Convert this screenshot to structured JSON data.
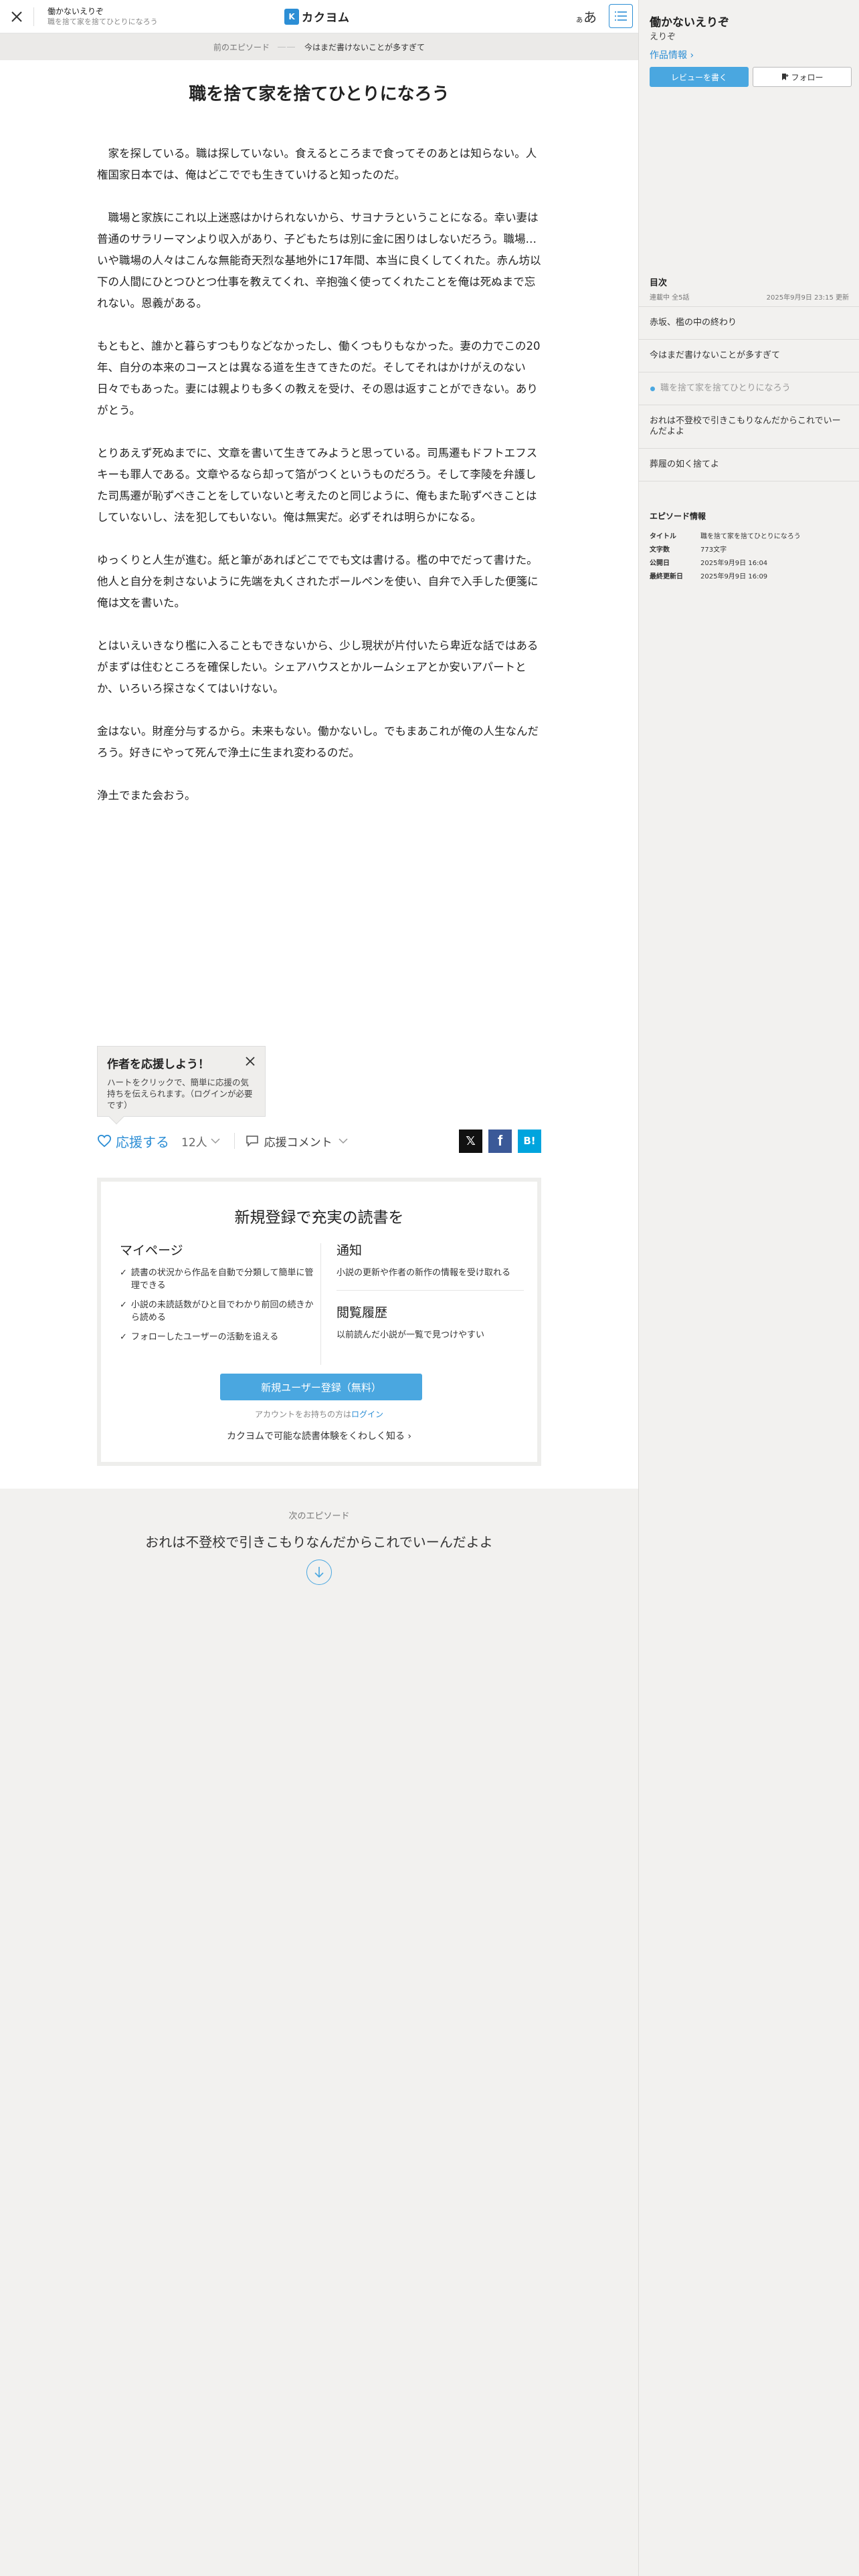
{
  "header": {
    "work_title": "働かないえりぞ",
    "episode_title": "職を捨て家を捨てひとりになろう",
    "logo_text": "カクヨム",
    "logo_mark": "K",
    "font_toggle_small": "ぁ",
    "font_toggle_big": "あ"
  },
  "prev": {
    "label": "前のエピソード",
    "dots": "――",
    "title": "今はまだ書けないことが多すぎて"
  },
  "episode": {
    "heading": "職を捨て家を捨てひとりになろう",
    "paragraphs": [
      [
        "　家を探している。職は探していない。食えるところまで食ってそのあとは知らない。人権国家日本では、俺はどこででも生きていけると知ったのだ。"
      ],
      [
        "　職場と家族にこれ以上迷惑はかけられないから、サヨナラということになる。幸い妻は普通のサラリーマンより収入があり、子どもたちは別に金に困りはしないだろう。職場…いや職場の人々はこんな無能奇天烈な基地外に17年間、本当に良くしてくれた。赤ん坊以下の人間にひとつひとつ仕事を教えてくれ、辛抱強く使ってくれたことを俺は死ぬまで忘れない。恩義がある。"
      ],
      [
        "もともと、誰かと暮らすつもりなどなかったし、働くつもりもなかった。妻の力でこの20年、自分の本来のコースとは異なる道を生きてきたのだ。そしてそれはかけがえのない日々でもあった。妻には親よりも多くの教えを受け、その恩は返すことができない。ありがとう。"
      ],
      [
        "とりあえず死ぬまでに、文章を書いて生きてみようと思っている。司馬遷もドフトエフスキーも罪人である。文章やるなら却って箔がつくというものだろう。そして李陵を弁護した司馬遷が恥ずべきことをしていないと考えたのと同じように、俺もまた恥ずべきことはしていないし、法を犯してもいない。俺は無実だ。必ずそれは明らかになる。"
      ],
      [
        "ゆっくりと人生が進む。紙と筆があればどこででも文は書ける。檻の中でだって書けた。他人と自分を刺さないように先端を丸くされたボールペンを使い、自弁で入手した便箋に俺は文を書いた。"
      ],
      [
        "とはいえいきなり檻に入ることもできないから、少し現状が片付いたら卑近な話ではあるがまずは住むところを確保したい。シェアハウスとかルームシェアとか安いアパートとか、いろいろ探さなくてはいけない。"
      ],
      [
        "金はない。財産分与するから。未来もない。働かないし。でもまあこれが俺の人生なんだろう。好きにやって死んで浄土に生まれ変わるのだ。"
      ],
      [
        "浄土でまた会おう。"
      ]
    ]
  },
  "tip": {
    "title": "作者を応援しよう！",
    "body": "ハートをクリックで、簡単に応援の気持ちを伝えられます。（ログインが必要です）"
  },
  "actions": {
    "cheer_label": "応援する",
    "cheer_count": "12人",
    "comment_label": "応援コメント",
    "share_x": "𝕏",
    "share_fb": "f",
    "share_hb": "B!"
  },
  "signup": {
    "title": "新規登録で充実の読書を",
    "left_heading": "マイページ",
    "checks": [
      "読書の状況から作品を自動で分類して簡単に管理できる",
      "小説の未読話数がひと目でわかり前回の続きから読める",
      "フォローしたユーザーの活動を追える"
    ],
    "notify_heading": "通知",
    "notify_text": "小説の更新や作者の新作の情報を受け取れる",
    "history_heading": "閲覧履歴",
    "history_text": "以前読んだ小説が一覧で見つけやすい",
    "register_button": "新規ユーザー登録（無料）",
    "login_prefix": "アカウントをお持ちの方は",
    "login_link": "ログイン",
    "more_link": "カクヨムで可能な読書体験をくわしく知る"
  },
  "next": {
    "label": "次のエピソード",
    "title": "おれは不登校で引きこもりなんだからこれでいーんだよよ"
  },
  "sidebar": {
    "work_title": "働かないえりぞ",
    "author": "えりぞ",
    "info_link": "作品情報",
    "review_button": "レビューを書く",
    "follow_button": "フォロー",
    "toc_heading": "目次",
    "toc_status": "連載中 全5話",
    "toc_updated": "2025年9月9日 23:15 更新",
    "toc_items": [
      "赤坂、檻の中の終わり",
      "今はまだ書けないことが多すぎて",
      "職を捨て家を捨てひとりになろう",
      "おれは不登校で引きこもりなんだからこれでいーんだよよ",
      "葬履の如く捨てよ"
    ],
    "current_index": 2,
    "epinfo_heading": "エピソード情報",
    "epinfo": [
      {
        "k": "タイトル",
        "v": "職を捨て家を捨てひとりになろう"
      },
      {
        "k": "文字数",
        "v": "773文字"
      },
      {
        "k": "公開日",
        "v": "2025年9月9日 16:04"
      },
      {
        "k": "最終更新日",
        "v": "2025年9月9日 16:09"
      }
    ]
  }
}
